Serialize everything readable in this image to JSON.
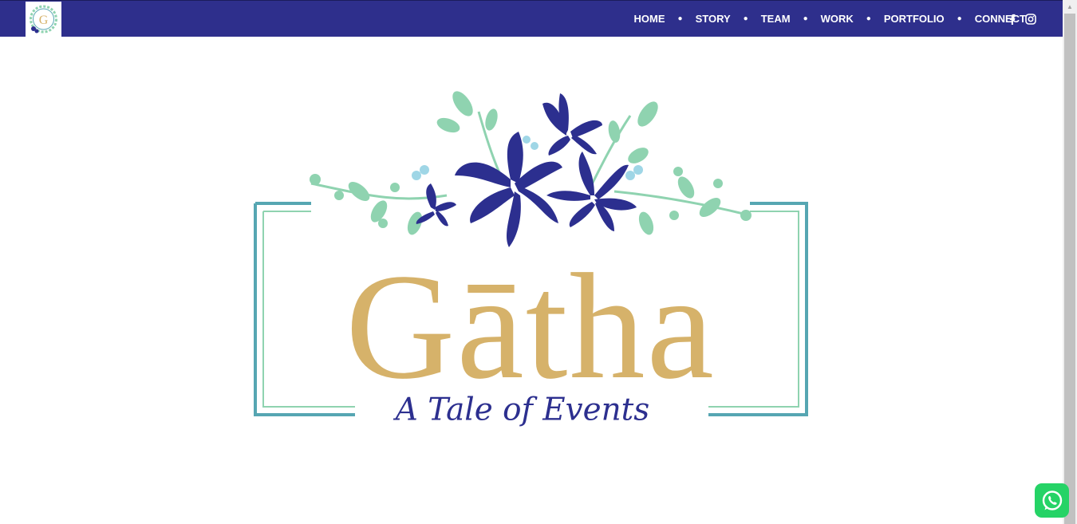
{
  "nav": {
    "logo_letter": "G",
    "items": [
      "HOME",
      "STORY",
      "TEAM",
      "WORK",
      "PORTFOLIO",
      "CONNECT"
    ],
    "social": [
      "facebook-icon",
      "instagram-icon"
    ]
  },
  "hero": {
    "brand": "Gātha",
    "tagline": "A Tale of Events"
  },
  "colors": {
    "nav_bg": "#2e2f8c",
    "gold": "#d6b26a",
    "navy": "#2c2f8f",
    "teal_frame": "#56a6b2",
    "mint_leaf": "#8fd3b0",
    "whatsapp": "#25d366"
  },
  "floating": {
    "whatsapp_icon": "whatsapp-icon"
  }
}
